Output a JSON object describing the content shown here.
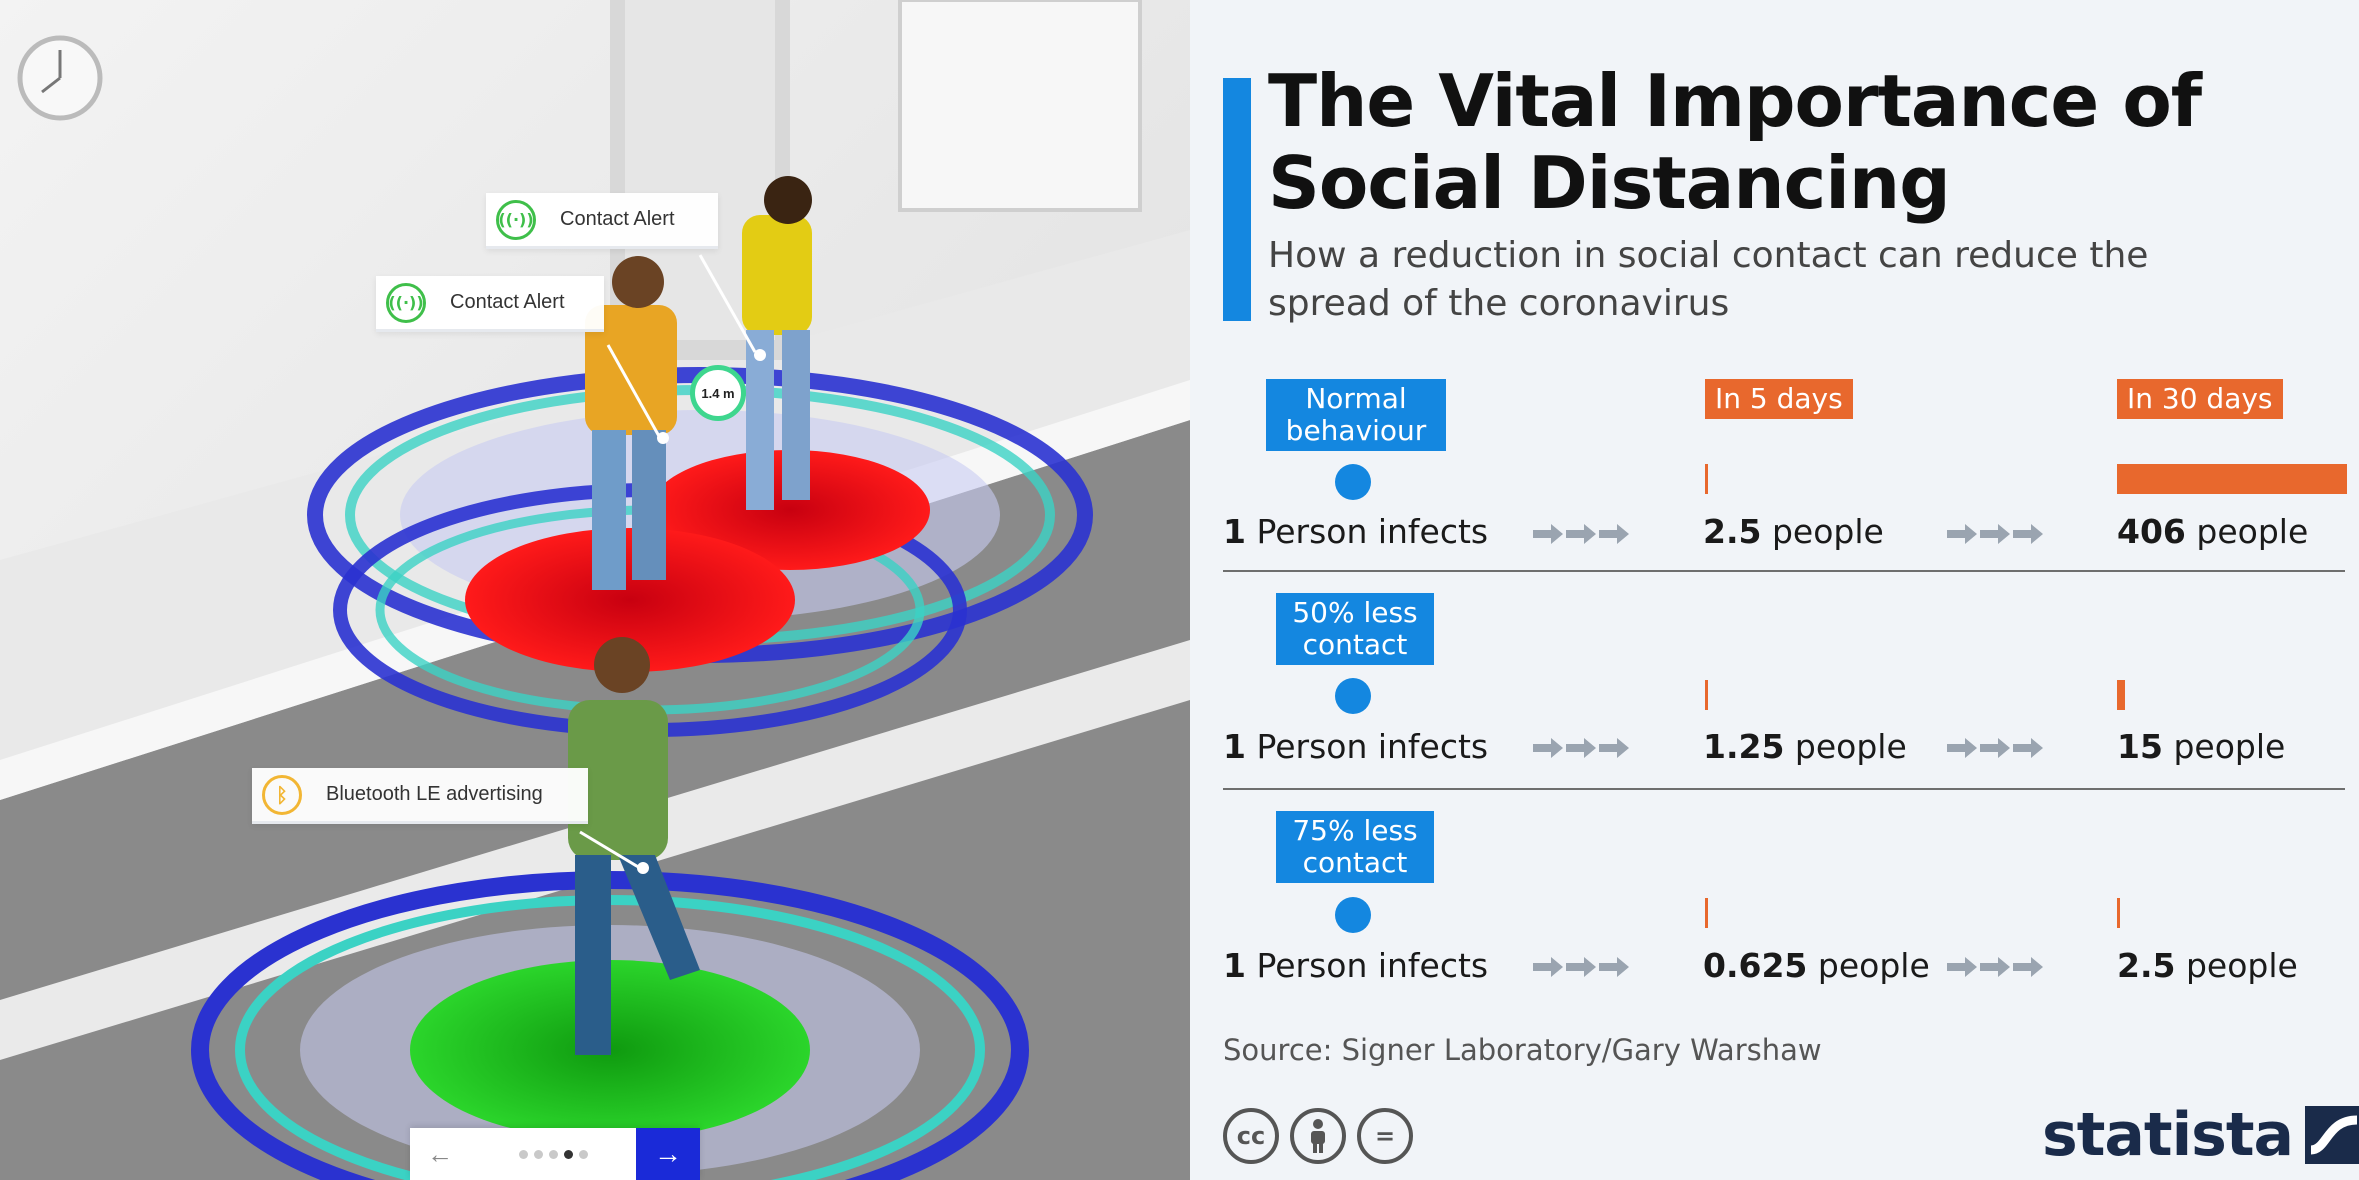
{
  "scene": {
    "tags": {
      "contact_alert_1": "Contact Alert",
      "contact_alert_2": "Contact Alert",
      "bluetooth": "Bluetooth LE advertising"
    },
    "distance": "1.4 m",
    "pager": {
      "prev_icon": "arrow-left-icon",
      "next_icon": "arrow-right-icon",
      "active_dot": 4,
      "dot_count": 5
    }
  },
  "info": {
    "title": "The Vital Importance of Social Distancing",
    "subtitle": "How a reduction in social contact can reduce the spread of the coronavirus",
    "columns": {
      "five_days": "In 5 days",
      "thirty_days": "In 30 days"
    },
    "rows": [
      {
        "label": "Normal behaviour",
        "start_value": "1",
        "start_text": "Person infects",
        "d5_value": "2.5",
        "d5_text": "people",
        "d30_value": "406",
        "d30_text": "people",
        "d5_num": 2.5,
        "d30_num": 406
      },
      {
        "label": "50% less contact",
        "start_value": "1",
        "start_text": "Person infects",
        "d5_value": "1.25",
        "d5_text": "people",
        "d30_value": "15",
        "d30_text": "people",
        "d5_num": 1.25,
        "d30_num": 15
      },
      {
        "label": "75% less contact",
        "start_value": "1",
        "start_text": "Person infects",
        "d5_value": "0.625",
        "d5_text": "people",
        "d30_value": "2.5",
        "d30_text": "people",
        "d5_num": 0.625,
        "d30_num": 2.5
      }
    ],
    "source": "Source: Signer Laboratory/Gary Warshaw",
    "license_icons": [
      "creative-commons-icon",
      "attribution-icon",
      "no-derivatives-icon"
    ],
    "license_text": {
      "cc": "cc",
      "nd": "="
    },
    "brand": "statista",
    "colors": {
      "accent_blue": "#1487e0",
      "accent_orange": "#e8682d"
    }
  }
}
